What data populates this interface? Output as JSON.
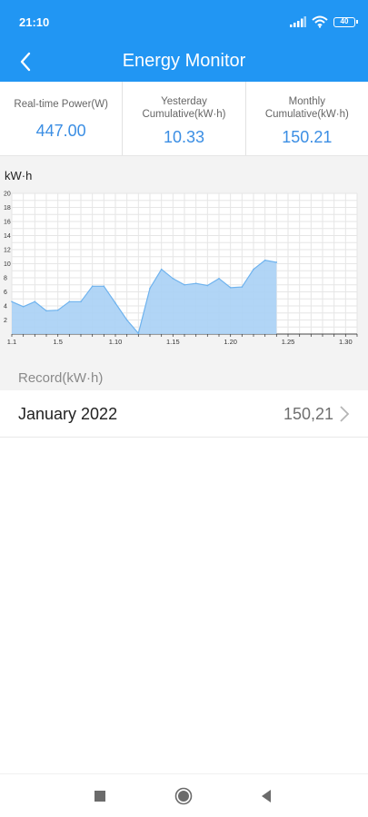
{
  "status_bar": {
    "time": "21:10",
    "battery": "40",
    "icons": [
      "signal-icon",
      "wifi-icon",
      "battery-icon"
    ]
  },
  "header": {
    "title": "Energy Monitor",
    "back_icon": "chevron-left-icon"
  },
  "summary": [
    {
      "label": "Real-time Power(W)",
      "value": "447.00"
    },
    {
      "label": "Yesterday Cumulative(kW·h)",
      "value": "10.33"
    },
    {
      "label": "Monthly Cumulative(kW·h)",
      "value": "150.21"
    }
  ],
  "chart_data": {
    "type": "area",
    "ylabel": "kW·h",
    "ylim": [
      0,
      20
    ],
    "yticks": [
      "20",
      "18",
      "16",
      "14",
      "12",
      "10",
      "8",
      "6",
      "4",
      "2"
    ],
    "xticks": [
      "1.1",
      "1.5",
      "1.10",
      "1.15",
      "1.20",
      "1.25",
      "1.30"
    ],
    "days": 31,
    "grid": true,
    "color": "#a9d0f5",
    "line_color": "#6fb3ee",
    "x": [
      "1.1",
      "1.2",
      "1.3",
      "1.4",
      "1.5",
      "1.6",
      "1.7",
      "1.8",
      "1.9",
      "1.10",
      "1.11",
      "1.12",
      "1.13",
      "1.14",
      "1.15",
      "1.16",
      "1.17",
      "1.18",
      "1.19",
      "1.20",
      "1.21",
      "1.22",
      "1.23",
      "1.24"
    ],
    "values": [
      4.6,
      3.9,
      4.6,
      3.3,
      3.4,
      4.6,
      4.6,
      6.8,
      6.8,
      4.4,
      2.0,
      0.1,
      6.5,
      9.2,
      7.9,
      7.0,
      7.2,
      6.9,
      7.9,
      6.6,
      6.7,
      9.2,
      10.5,
      10.2
    ]
  },
  "records": {
    "section_title": "Record(kW·h)",
    "items": [
      {
        "month": "January 2022",
        "value": "150,21"
      }
    ]
  },
  "nav": {
    "recents_icon": "square-icon",
    "home_icon": "circle-icon",
    "back_icon": "triangle-back-icon"
  }
}
